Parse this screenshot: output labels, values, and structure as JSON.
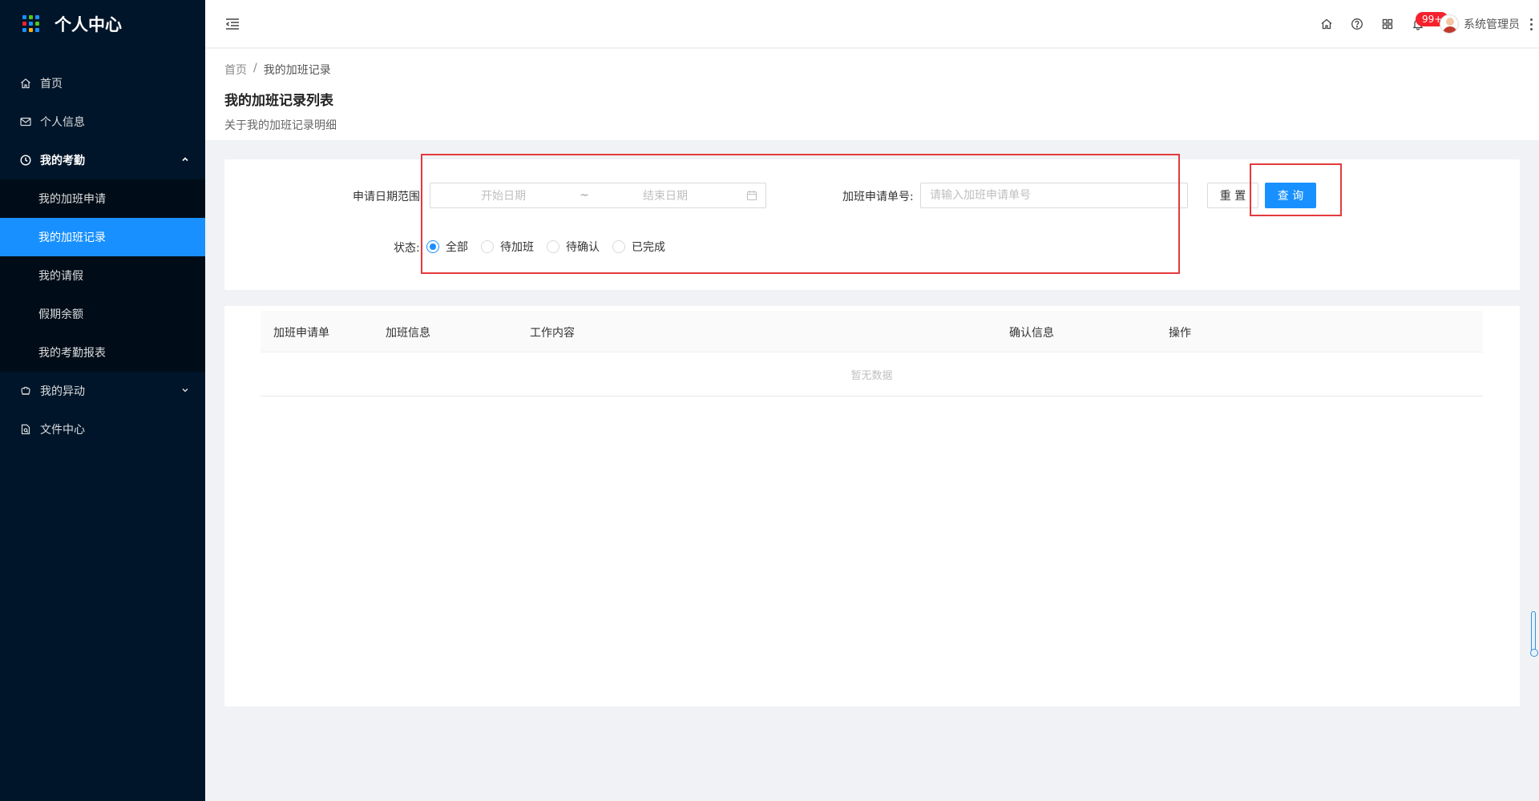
{
  "app": {
    "title": "个人中心"
  },
  "sidebar": {
    "items": [
      {
        "label": "首页",
        "icon": "home-icon"
      },
      {
        "label": "个人信息",
        "icon": "mail-icon"
      },
      {
        "label": "我的考勤",
        "icon": "clock-icon",
        "open": true,
        "children": [
          {
            "label": "我的加班申请"
          },
          {
            "label": "我的加班记录",
            "active": true
          },
          {
            "label": "我的请假"
          },
          {
            "label": "假期余额"
          },
          {
            "label": "我的考勤报表"
          }
        ]
      },
      {
        "label": "我的异动",
        "icon": "flower-icon"
      },
      {
        "label": "文件中心",
        "icon": "file-search-icon"
      }
    ]
  },
  "header": {
    "notification_badge": "99+",
    "user_name": "系统管理员"
  },
  "page": {
    "breadcrumb": [
      "首页",
      "我的加班记录"
    ],
    "breadcrumb_sep": "/",
    "title": "我的加班记录列表",
    "description": "关于我的加班记录明细"
  },
  "filter": {
    "date_range_label": "申请日期范围",
    "start_placeholder": "开始日期",
    "range_sep": "~",
    "end_placeholder": "结束日期",
    "order_no_label": "加班申请单号:",
    "order_no_placeholder": "请输入加班申请单号",
    "reset_label": "重 置",
    "query_label": "查 询",
    "status_label": "状态:",
    "status_options": [
      "全部",
      "待加班",
      "待确认",
      "已完成"
    ],
    "status_selected": "全部"
  },
  "table": {
    "columns": [
      "加班申请单",
      "加班信息",
      "工作内容",
      "确认信息",
      "操作"
    ],
    "empty_text": "暂无数据"
  },
  "colors": {
    "sidebar_bg": "#001529",
    "primary": "#1890ff",
    "highlight_box": "#e4393c"
  }
}
